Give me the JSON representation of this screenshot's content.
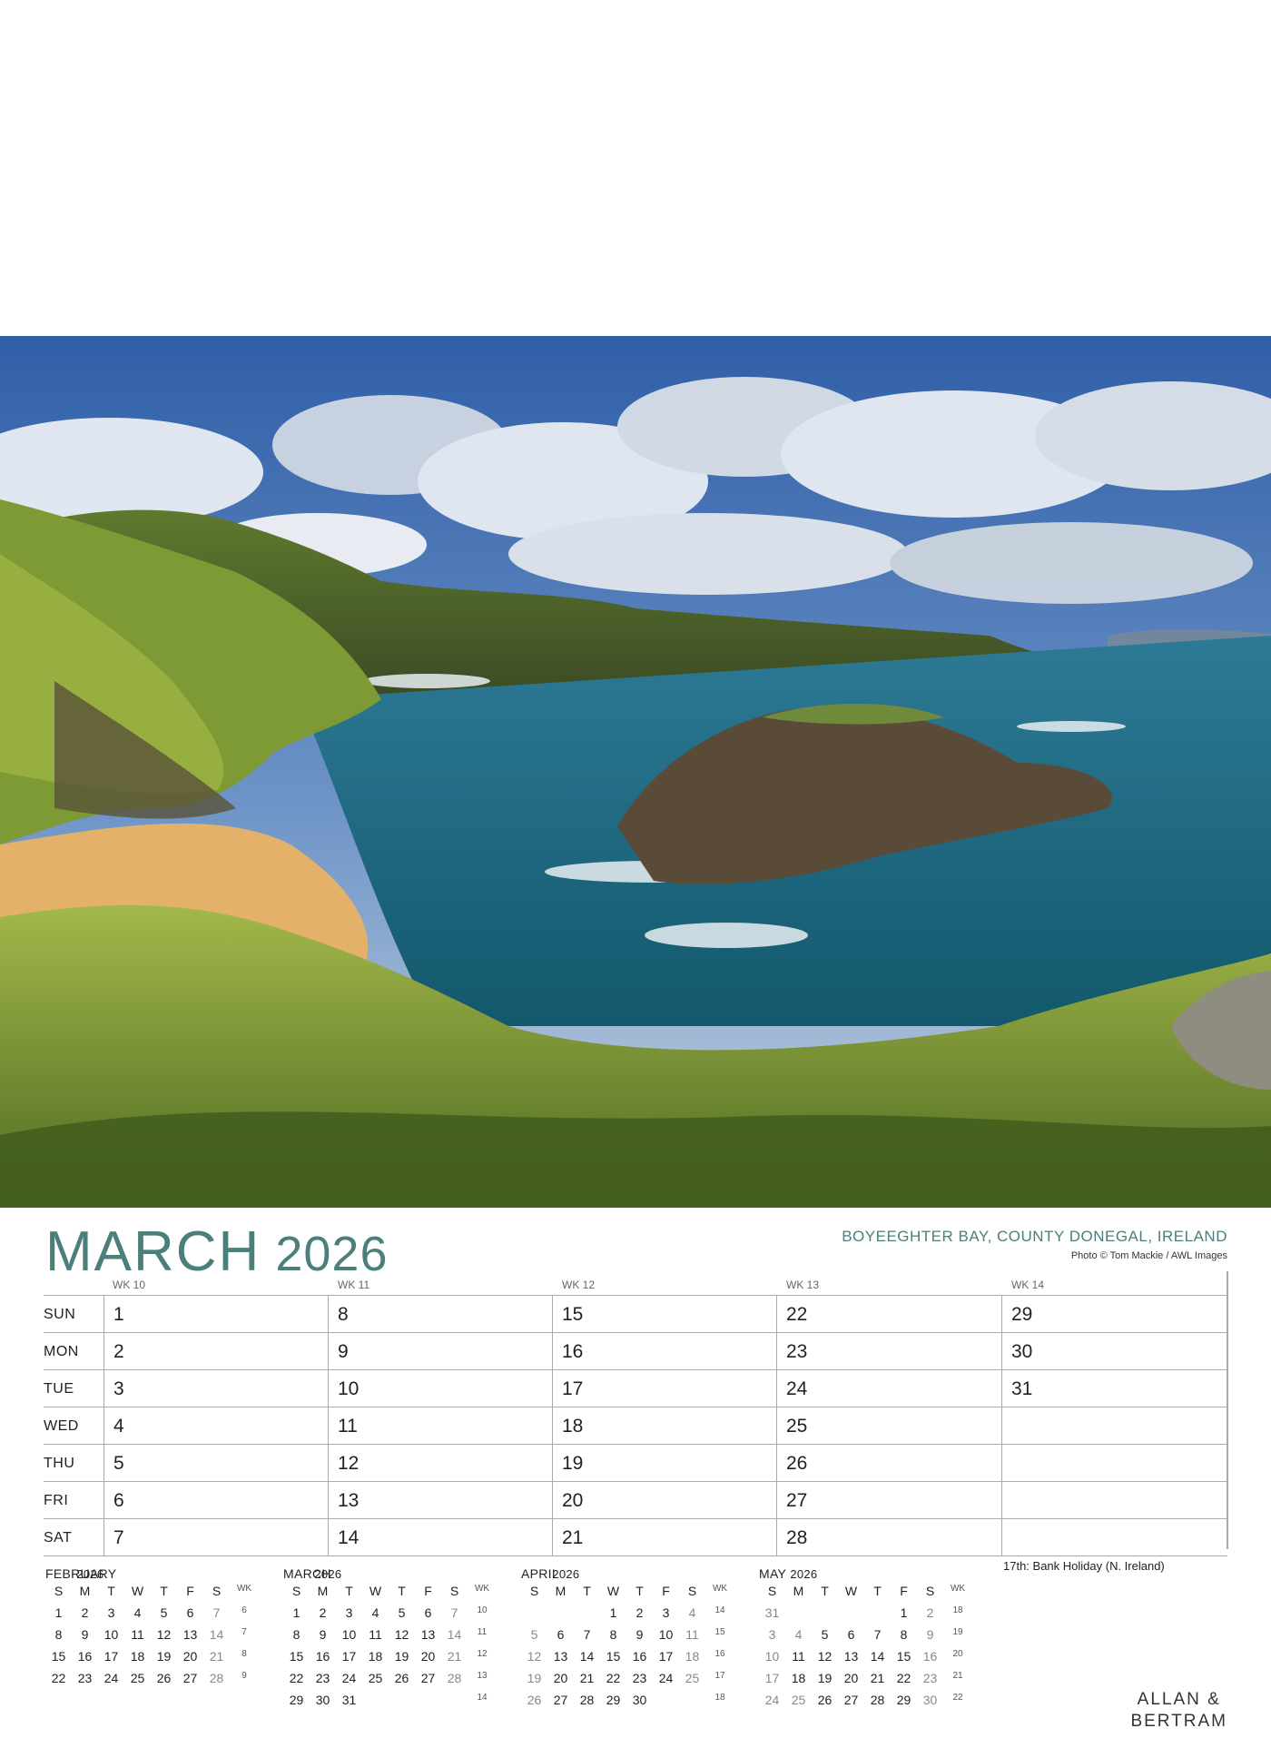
{
  "photo": {
    "subject": "coastal-landscape",
    "colors": {
      "sky": "#3f6fb8",
      "cloud": "#e8ecf2",
      "sea": "#1f6e86",
      "grass": "#8aa83a",
      "sand": "#e3b169",
      "rock": "#4a4433"
    }
  },
  "header": {
    "month": "MARCH",
    "year": "2026",
    "location": "BOYEEGHTER BAY, COUNTY DONEGAL, IRELAND",
    "credit": "Photo © Tom Mackie / AWL Images"
  },
  "weeks": [
    "WK 10",
    "WK 11",
    "WK 12",
    "WK 13",
    "WK 14"
  ],
  "days": [
    {
      "name": "SUN",
      "dates": [
        "1",
        "8",
        "15",
        "22",
        "29"
      ]
    },
    {
      "name": "MON",
      "dates": [
        "2",
        "9",
        "16",
        "23",
        "30"
      ]
    },
    {
      "name": "TUE",
      "dates": [
        "3",
        "10",
        "17",
        "24",
        "31"
      ]
    },
    {
      "name": "WED",
      "dates": [
        "4",
        "11",
        "18",
        "25",
        ""
      ]
    },
    {
      "name": "THU",
      "dates": [
        "5",
        "12",
        "19",
        "26",
        ""
      ]
    },
    {
      "name": "FRI",
      "dates": [
        "6",
        "13",
        "20",
        "27",
        ""
      ]
    },
    {
      "name": "SAT",
      "dates": [
        "7",
        "14",
        "21",
        "28",
        ""
      ]
    }
  ],
  "mini_headers": [
    "S",
    "M",
    "T",
    "W",
    "T",
    "F",
    "S",
    "WK"
  ],
  "mini_calendars": [
    {
      "month": "FEBRUARY",
      "year": "2026",
      "rows": [
        [
          "1",
          "2",
          "3",
          "4",
          "5",
          "6",
          "7",
          "6"
        ],
        [
          "8",
          "9",
          "10",
          "11",
          "12",
          "13",
          "14",
          "7"
        ],
        [
          "15",
          "16",
          "17",
          "18",
          "19",
          "20",
          "21",
          "8"
        ],
        [
          "22",
          "23",
          "24",
          "25",
          "26",
          "27",
          "28",
          "9"
        ],
        [
          "",
          "",
          "",
          "",
          "",
          "",
          "",
          ""
        ]
      ]
    },
    {
      "month": "MARCH",
      "year": "2026",
      "rows": [
        [
          "1",
          "2",
          "3",
          "4",
          "5",
          "6",
          "7",
          "10"
        ],
        [
          "8",
          "9",
          "10",
          "11",
          "12",
          "13",
          "14",
          "11"
        ],
        [
          "15",
          "16",
          "17",
          "18",
          "19",
          "20",
          "21",
          "12"
        ],
        [
          "22",
          "23",
          "24",
          "25",
          "26",
          "27",
          "28",
          "13"
        ],
        [
          "29",
          "30",
          "31",
          "",
          "",
          "",
          "",
          "14"
        ]
      ]
    },
    {
      "month": "APRIL",
      "year": "2026",
      "rows": [
        [
          "",
          "",
          "",
          "1",
          "2",
          "3",
          "4",
          "14"
        ],
        [
          "5",
          "6",
          "7",
          "8",
          "9",
          "10",
          "11",
          "15"
        ],
        [
          "12",
          "13",
          "14",
          "15",
          "16",
          "17",
          "18",
          "16"
        ],
        [
          "19",
          "20",
          "21",
          "22",
          "23",
          "24",
          "25",
          "17"
        ],
        [
          "26",
          "27",
          "28",
          "29",
          "30",
          "",
          "",
          "18"
        ]
      ]
    },
    {
      "month": "MAY",
      "year": "2026",
      "rows": [
        [
          "31",
          "",
          "",
          "",
          "",
          "1",
          "2",
          "18"
        ],
        [
          "3",
          "4",
          "5",
          "6",
          "7",
          "8",
          "9",
          "19"
        ],
        [
          "10",
          "11",
          "12",
          "13",
          "14",
          "15",
          "16",
          "20"
        ],
        [
          "17",
          "18",
          "19",
          "20",
          "21",
          "22",
          "23",
          "21"
        ],
        [
          "24",
          "25",
          "26",
          "27",
          "28",
          "29",
          "30",
          "22"
        ]
      ]
    }
  ],
  "note": "17th: Bank Holiday (N. Ireland)",
  "brand": {
    "line1": "ALLAN &",
    "line2": "BERTRAM"
  }
}
